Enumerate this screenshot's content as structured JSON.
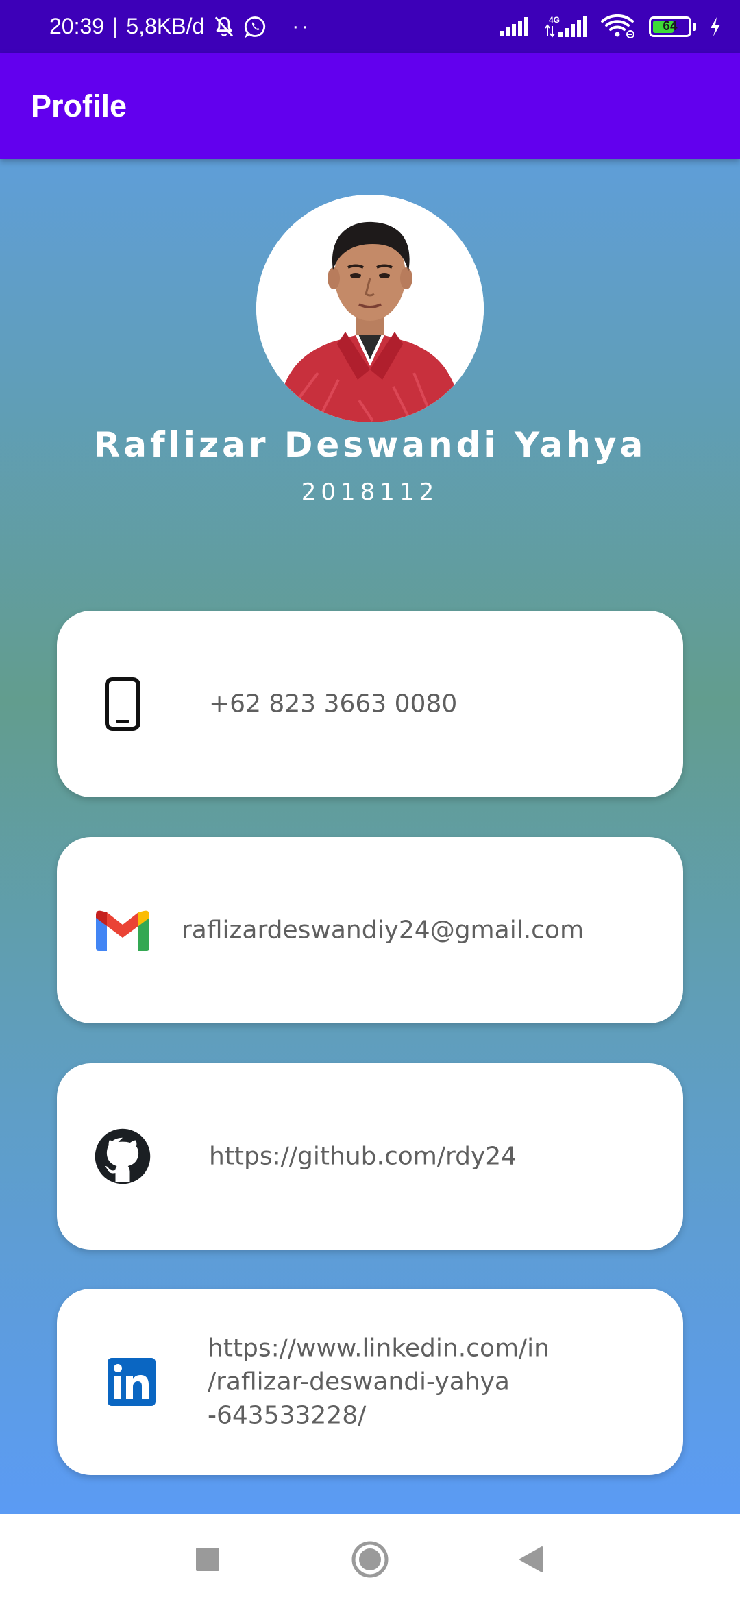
{
  "status_bar": {
    "time": "20:39",
    "separator": "|",
    "speed": "5,8KB/d",
    "more_dots": "··",
    "network_label": "4G",
    "battery_level": "64",
    "battery_fraction": 0.64,
    "battery_color": "#3ddc38"
  },
  "app_bar": {
    "title": "Profile",
    "color": "#6200ee"
  },
  "profile": {
    "name": "Raflizar Deswandi Yahya",
    "id": "2018112"
  },
  "contacts": [
    {
      "icon": "phone-icon",
      "text": "+62 823 3663 0080"
    },
    {
      "icon": "gmail-icon",
      "text": "raflizardeswandiy24@gmail.com"
    },
    {
      "icon": "github-icon",
      "text": "https://github.com/rdy24"
    },
    {
      "icon": "linkedin-icon",
      "lines": [
        "https://www.linkedin.com/in",
        "/raflizar-deswandi-yahya",
        "-643533228/"
      ]
    }
  ],
  "nav_bar": {
    "buttons": [
      "recents-button",
      "home-button",
      "back-button"
    ]
  }
}
